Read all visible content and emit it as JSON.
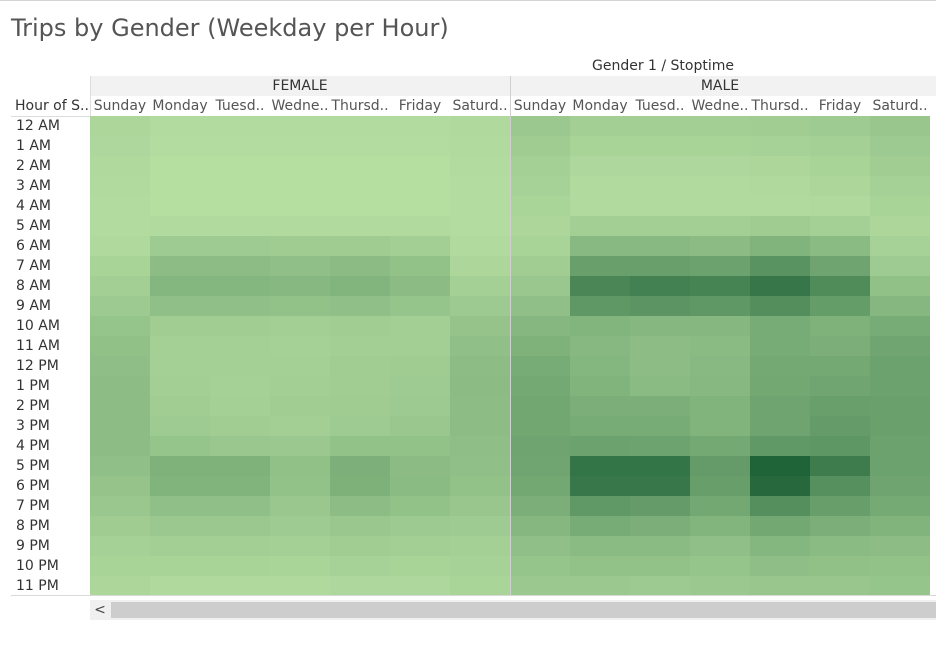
{
  "title": "Trips by Gender (Weekday per Hour)",
  "column_super_header": "Gender 1 / Stoptime",
  "row_header_label": "Hour of S..",
  "chart_data": {
    "type": "heatmap",
    "title": "Trips by Gender (Weekday per Hour)",
    "column_header": "Gender 1 / Stoptime",
    "row_header": "Hour of S..",
    "genders": [
      "FEMALE",
      "MALE"
    ],
    "days_labels": [
      "Sunday",
      "Monday",
      "Tuesd..",
      "Wedne..",
      "Thursd..",
      "Friday",
      "Saturd.."
    ],
    "hours": [
      "12 AM",
      "1 AM",
      "2 AM",
      "3 AM",
      "4 AM",
      "5 AM",
      "6 AM",
      "7 AM",
      "8 AM",
      "9 AM",
      "10 AM",
      "11 AM",
      "12 PM",
      "1 PM",
      "2 PM",
      "3 PM",
      "4 PM",
      "5 PM",
      "6 PM",
      "7 PM",
      "8 PM",
      "9 PM",
      "10 PM",
      "11 PM"
    ],
    "color_scale": {
      "low": "#b8e0a3",
      "high": "#1f6338"
    },
    "intensity_range": [
      0,
      1
    ],
    "intensity": {
      "FEMALE": [
        [
          0.08,
          0.04,
          0.04,
          0.04,
          0.04,
          0.04,
          0.06
        ],
        [
          0.07,
          0.03,
          0.03,
          0.03,
          0.03,
          0.03,
          0.05
        ],
        [
          0.06,
          0.02,
          0.02,
          0.02,
          0.02,
          0.02,
          0.04
        ],
        [
          0.05,
          0.02,
          0.02,
          0.02,
          0.02,
          0.02,
          0.03
        ],
        [
          0.04,
          0.02,
          0.02,
          0.02,
          0.02,
          0.02,
          0.03
        ],
        [
          0.04,
          0.05,
          0.05,
          0.05,
          0.05,
          0.05,
          0.03
        ],
        [
          0.06,
          0.17,
          0.17,
          0.16,
          0.16,
          0.14,
          0.05
        ],
        [
          0.1,
          0.28,
          0.28,
          0.26,
          0.29,
          0.24,
          0.08
        ],
        [
          0.14,
          0.34,
          0.34,
          0.32,
          0.35,
          0.29,
          0.13
        ],
        [
          0.18,
          0.26,
          0.26,
          0.24,
          0.26,
          0.22,
          0.18
        ],
        [
          0.22,
          0.15,
          0.15,
          0.14,
          0.15,
          0.14,
          0.23
        ],
        [
          0.25,
          0.13,
          0.13,
          0.12,
          0.14,
          0.14,
          0.26
        ],
        [
          0.27,
          0.13,
          0.13,
          0.13,
          0.15,
          0.16,
          0.28
        ],
        [
          0.28,
          0.14,
          0.12,
          0.14,
          0.15,
          0.17,
          0.29
        ],
        [
          0.28,
          0.15,
          0.13,
          0.15,
          0.16,
          0.18,
          0.28
        ],
        [
          0.28,
          0.17,
          0.15,
          0.14,
          0.17,
          0.2,
          0.28
        ],
        [
          0.28,
          0.22,
          0.2,
          0.19,
          0.24,
          0.24,
          0.27
        ],
        [
          0.26,
          0.37,
          0.37,
          0.25,
          0.39,
          0.29,
          0.26
        ],
        [
          0.23,
          0.36,
          0.36,
          0.24,
          0.38,
          0.3,
          0.24
        ],
        [
          0.2,
          0.26,
          0.26,
          0.2,
          0.28,
          0.24,
          0.21
        ],
        [
          0.16,
          0.19,
          0.19,
          0.17,
          0.2,
          0.18,
          0.17
        ],
        [
          0.12,
          0.14,
          0.14,
          0.13,
          0.15,
          0.14,
          0.13
        ],
        [
          0.1,
          0.1,
          0.1,
          0.09,
          0.11,
          0.1,
          0.11
        ],
        [
          0.08,
          0.06,
          0.06,
          0.06,
          0.07,
          0.07,
          0.09
        ]
      ],
      "MALE": [
        [
          0.19,
          0.14,
          0.14,
          0.14,
          0.15,
          0.17,
          0.21
        ],
        [
          0.16,
          0.1,
          0.1,
          0.1,
          0.11,
          0.13,
          0.18
        ],
        [
          0.13,
          0.07,
          0.07,
          0.07,
          0.08,
          0.1,
          0.15
        ],
        [
          0.11,
          0.05,
          0.05,
          0.05,
          0.06,
          0.08,
          0.12
        ],
        [
          0.09,
          0.05,
          0.05,
          0.05,
          0.05,
          0.06,
          0.1
        ],
        [
          0.08,
          0.14,
          0.14,
          0.14,
          0.16,
          0.13,
          0.08
        ],
        [
          0.1,
          0.31,
          0.31,
          0.29,
          0.36,
          0.3,
          0.11
        ],
        [
          0.15,
          0.52,
          0.52,
          0.5,
          0.62,
          0.48,
          0.17
        ],
        [
          0.2,
          0.72,
          0.76,
          0.74,
          0.85,
          0.68,
          0.25
        ],
        [
          0.26,
          0.58,
          0.6,
          0.58,
          0.66,
          0.54,
          0.33
        ],
        [
          0.33,
          0.35,
          0.33,
          0.33,
          0.42,
          0.37,
          0.42
        ],
        [
          0.37,
          0.32,
          0.28,
          0.3,
          0.42,
          0.4,
          0.47
        ],
        [
          0.42,
          0.34,
          0.28,
          0.31,
          0.44,
          0.44,
          0.5
        ],
        [
          0.44,
          0.36,
          0.3,
          0.32,
          0.45,
          0.47,
          0.5
        ],
        [
          0.46,
          0.4,
          0.4,
          0.36,
          0.48,
          0.52,
          0.51
        ],
        [
          0.46,
          0.42,
          0.42,
          0.36,
          0.48,
          0.55,
          0.51
        ],
        [
          0.48,
          0.5,
          0.49,
          0.44,
          0.57,
          0.59,
          0.5
        ],
        [
          0.47,
          0.86,
          0.86,
          0.55,
          1.0,
          0.8,
          0.5
        ],
        [
          0.45,
          0.84,
          0.84,
          0.53,
          0.95,
          0.64,
          0.48
        ],
        [
          0.4,
          0.57,
          0.55,
          0.45,
          0.65,
          0.53,
          0.43
        ],
        [
          0.33,
          0.42,
          0.4,
          0.35,
          0.45,
          0.4,
          0.36
        ],
        [
          0.26,
          0.3,
          0.3,
          0.26,
          0.34,
          0.3,
          0.28
        ],
        [
          0.22,
          0.24,
          0.24,
          0.22,
          0.27,
          0.25,
          0.24
        ],
        [
          0.19,
          0.19,
          0.18,
          0.19,
          0.21,
          0.21,
          0.22
        ]
      ]
    },
    "grid": false,
    "legend": "none"
  }
}
